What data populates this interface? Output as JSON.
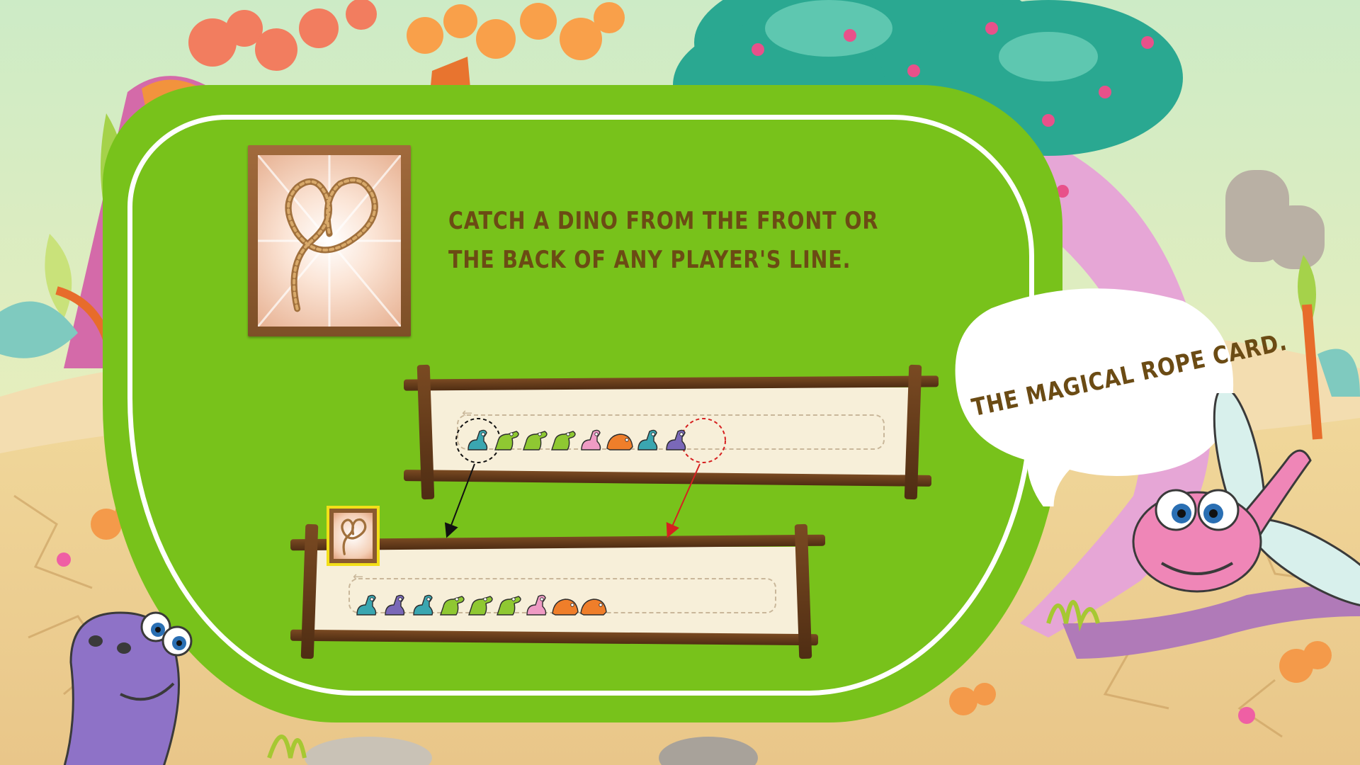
{
  "card": {
    "name": "Magical Rope Card",
    "icon": "rope-icon"
  },
  "instruction": {
    "line1": "CATCH A DINO FROM THE FRONT OR",
    "line2": "THE BACK OF ANY PLAYER'S LINE."
  },
  "bubble": {
    "text": "THE MAGICAL ROPE CARD."
  },
  "lines": {
    "top": [
      "teal",
      "green",
      "green",
      "green",
      "pink",
      "orange",
      "teal",
      "purple"
    ],
    "bottom": [
      "teal",
      "purple",
      "teal",
      "green",
      "green",
      "green",
      "pink",
      "orange",
      "orange"
    ]
  },
  "colors": {
    "board": "#78c21b",
    "text": "#6b4b14",
    "wood": "#5a3318",
    "paper": "#f7efd9",
    "highlight": "#f3df18",
    "arrow_black": "#111111",
    "arrow_red": "#d62020"
  }
}
